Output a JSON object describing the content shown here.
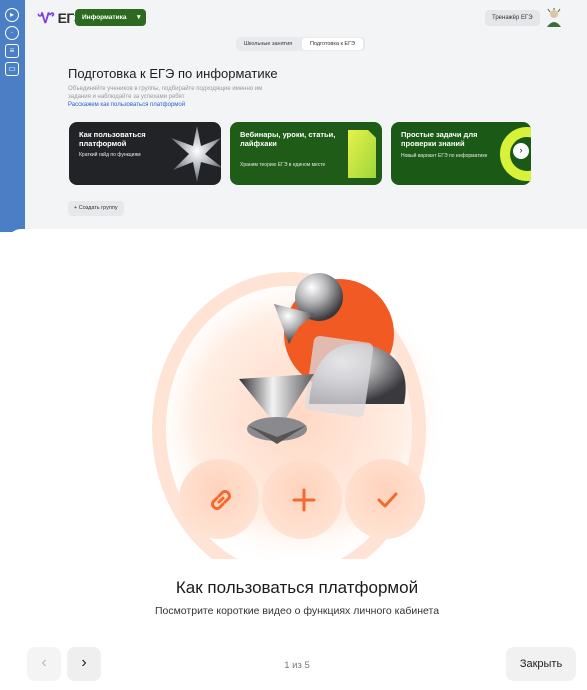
{
  "header": {
    "logo_text": "ЕГЭ",
    "subject_selector": "Информатика",
    "trainer_button": "Тренажёр ЕГЭ"
  },
  "left_rail": {
    "icons": [
      "play-circle-icon",
      "clock-icon",
      "video-icon",
      "document-icon"
    ]
  },
  "tabs": [
    "Школьные занятия",
    "Подготовка к ЕГЭ"
  ],
  "page": {
    "title": "Подготовка к ЕГЭ по информатике",
    "description": "Объединяйте учеников в группы, подбирайте подходящие именно им задания и наблюдайте за успехами ребят",
    "link": "Расскажем как пользоваться платформой"
  },
  "cards": [
    {
      "title": "Как пользоваться платформой",
      "subtitle": "Краткий гайд по функциям"
    },
    {
      "title": "Вебинары, уроки, статьи, лайфхаки",
      "subtitle": "Храним теорию ЕГЭ в едином месте"
    },
    {
      "title": "Простые задачи для проверки знаний",
      "subtitle": "Новый вариант ЕГЭ по информатике"
    }
  ],
  "create_group_button": "+ Создать группу",
  "modal": {
    "title": "Как пользоваться платформой",
    "subtitle": "Посмотрите короткие видео о функциях личного кабинета",
    "counter": "1 из 5",
    "close_button": "Закрыть"
  },
  "colors": {
    "accent_orange": "#f26a2e",
    "subject_green": "#2c6b1f",
    "link_blue": "#2a5fd1",
    "rail_blue": "#4a7fc6"
  }
}
